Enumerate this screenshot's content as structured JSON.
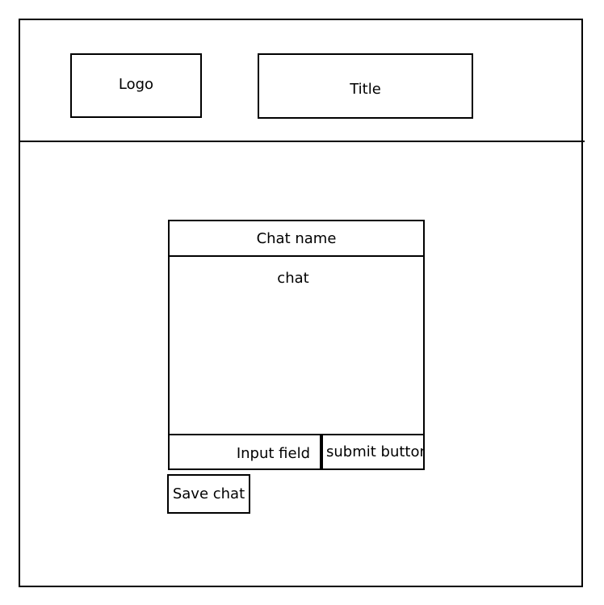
{
  "header": {
    "logo_label": "Logo",
    "title_label": "Title"
  },
  "chat": {
    "name_label": "Chat name",
    "body_label": "chat",
    "input_label": "Input field",
    "submit_label": "submit button",
    "save_label": "Save chat"
  }
}
